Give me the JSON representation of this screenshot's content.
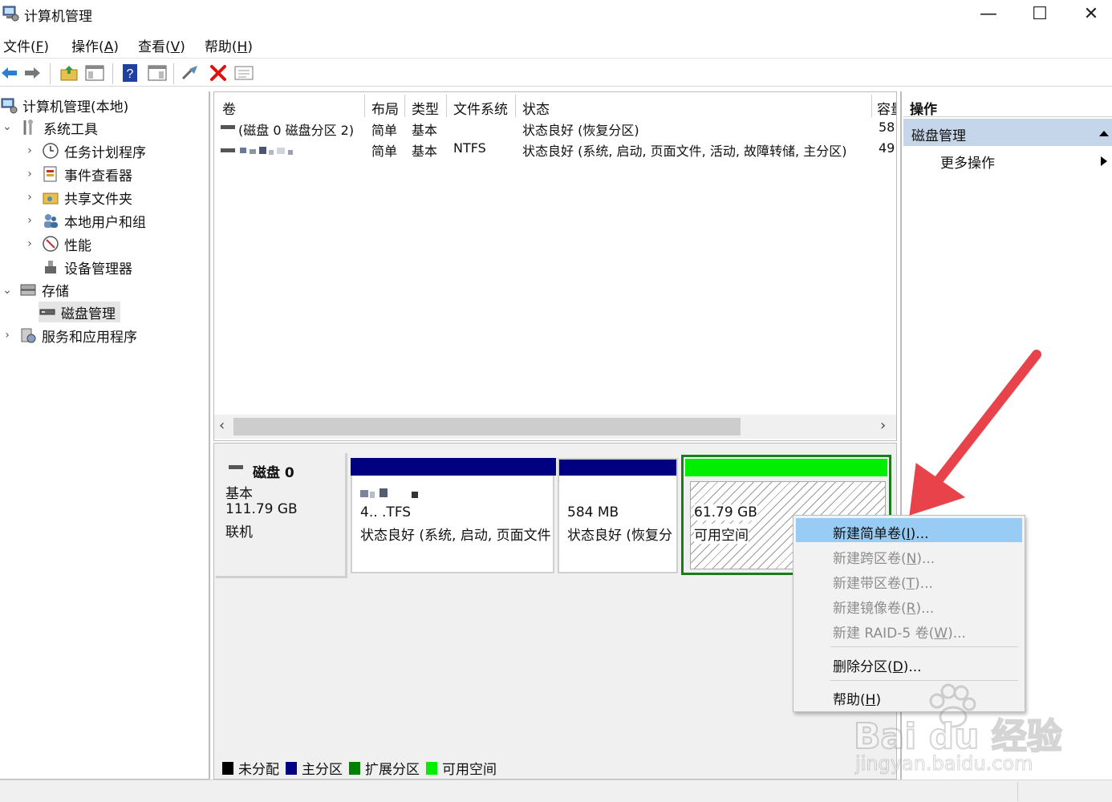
{
  "window": {
    "title": "计算机管理",
    "controls": {
      "minimize": "—",
      "maximize": "☐",
      "close": "✕"
    }
  },
  "menu": [
    {
      "text": "文件(",
      "key": "F",
      "end": ")"
    },
    {
      "text": "操作(",
      "key": "A",
      "end": ")"
    },
    {
      "text": "查看(",
      "key": "V",
      "end": ")"
    },
    {
      "text": "帮助(",
      "key": "H",
      "end": ")"
    }
  ],
  "toolbar": {
    "icons": [
      "back-arrow-icon",
      "forward-arrow-icon",
      "up-folder-icon",
      "show-hide-tree-icon",
      "help-icon",
      "properties-icon",
      "connect-icon",
      "delete-icon",
      "list-icon"
    ],
    "colors": {
      "delete": "#e01010",
      "nav": "#2a7fd4"
    }
  },
  "tree": {
    "root": "计算机管理(本地)",
    "system_tools": "系统工具",
    "task_scheduler": "任务计划程序",
    "event_viewer": "事件查看器",
    "shared_folders": "共享文件夹",
    "local_users": "本地用户和组",
    "performance": "性能",
    "device_manager": "设备管理器",
    "storage": "存储",
    "disk_management": "磁盘管理",
    "services_apps": "服务和应用程序"
  },
  "volume_list": {
    "headers": [
      "卷",
      "布局",
      "类型",
      "文件系统",
      "状态",
      "容量"
    ],
    "rows": [
      {
        "volume": "(磁盘 0 磁盘分区 2)",
        "layout": "简单",
        "type": "基本",
        "fs": "",
        "status": "状态良好 (恢复分区)",
        "capacity": "58"
      },
      {
        "volume": "",
        "layout": "简单",
        "type": "基本",
        "fs": "NTFS",
        "status": "状态良好 (系统, 启动, 页面文件, 活动, 故障转储, 主分区)",
        "capacity": "49"
      }
    ]
  },
  "disk": {
    "name": "磁盘 0",
    "kind": "基本",
    "size": "111.79 GB",
    "state": "联机",
    "partitions": [
      {
        "size_line": "4.. .TFS",
        "status": "状态良好 (系统, 启动, 页面文件",
        "header_color": "#000080"
      },
      {
        "size_line": "584 MB",
        "status": "状态良好 (恢复分",
        "header_color": "#000080"
      },
      {
        "size_line": "61.79 GB",
        "status": "可用空间",
        "header_color": "#00ee00"
      }
    ]
  },
  "legend": [
    {
      "label": "未分配",
      "color": "#000000"
    },
    {
      "label": "主分区",
      "color": "#000080"
    },
    {
      "label": "扩展分区",
      "color": "#008000"
    },
    {
      "label": "可用空间",
      "color": "#00ee00"
    }
  ],
  "actions": {
    "header": "操作",
    "section": "磁盘管理",
    "more": "更多操作"
  },
  "context_menu": {
    "items": [
      {
        "pre": "新建简单卷(",
        "key": "I",
        "post": ")...",
        "enabled": true,
        "highlighted": true
      },
      {
        "pre": "新建跨区卷(",
        "key": "N",
        "post": ")...",
        "enabled": false
      },
      {
        "pre": "新建带区卷(",
        "key": "T",
        "post": ")...",
        "enabled": false
      },
      {
        "pre": "新建镜像卷(",
        "key": "R",
        "post": ")...",
        "enabled": false
      },
      {
        "pre": "新建 RAID-5 卷(",
        "key": "W",
        "post": ")...",
        "enabled": false
      },
      {
        "pre": "删除分区(",
        "key": "D",
        "post": ")...",
        "enabled": true
      },
      {
        "pre": "帮助(",
        "key": "H",
        "post": ")",
        "enabled": true
      }
    ]
  },
  "watermark": {
    "brand": "Bai du 经验",
    "url": "jingyan.baidu.com"
  },
  "annotation": {
    "arrow_color": "#e8424a"
  }
}
